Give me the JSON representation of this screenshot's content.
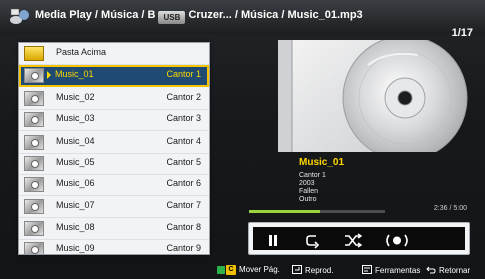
{
  "header": {
    "breadcrumb_left": "Media Play / Música / B",
    "usb_chip": "USB",
    "breadcrumb_right": "Cruzer... / Música / Music_01.mp3",
    "counter": "1/17"
  },
  "list": {
    "folder_label": "Pasta Acima",
    "items": [
      {
        "name": "Music_01",
        "artist": "Cantor 1"
      },
      {
        "name": "Music_02",
        "artist": "Cantor 2"
      },
      {
        "name": "Music_03",
        "artist": "Cantor 3"
      },
      {
        "name": "Music_04",
        "artist": "Cantor 4"
      },
      {
        "name": "Music_05",
        "artist": "Cantor 5"
      },
      {
        "name": "Music_06",
        "artist": "Cantor 6"
      },
      {
        "name": "Music_07",
        "artist": "Cantor 7"
      },
      {
        "name": "Music_08",
        "artist": "Cantor 8"
      },
      {
        "name": "Music_09",
        "artist": "Cantor 9"
      }
    ]
  },
  "track": {
    "title": "Music_01",
    "artist": "Cantor 1",
    "year": "2003",
    "album": "Fallen",
    "genre": "Outro",
    "time": "2:36 / 5:00",
    "progress": 0.52
  },
  "footer": {
    "move_page": "Mover Pág.",
    "play": "Reprod.",
    "tools": "Ferramentas",
    "back": "Retornar",
    "yellow_key": "C"
  },
  "colors": {
    "selected_text": "#ffd800",
    "selected_bg": "#1f4a72",
    "progress_fill": "#9cd33c"
  }
}
